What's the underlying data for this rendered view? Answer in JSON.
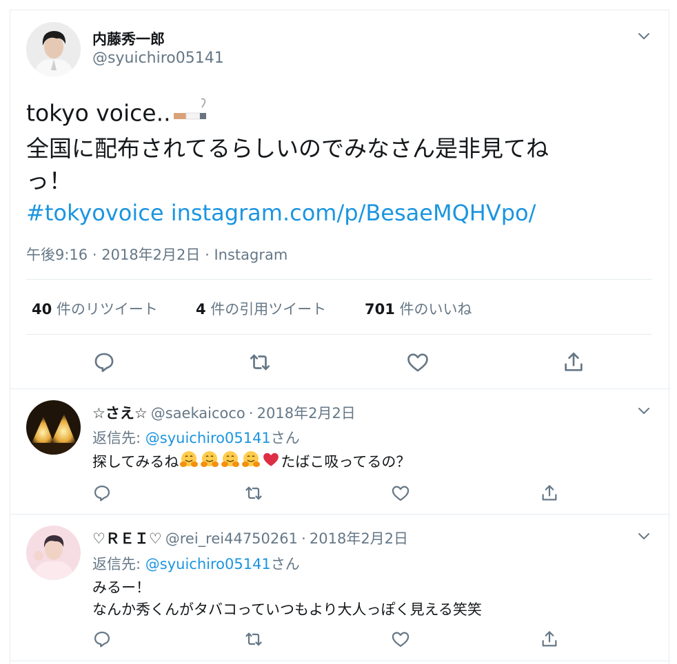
{
  "main_tweet": {
    "display_name": "内藤秀一郎",
    "handle": "@syuichiro05141",
    "text_line1": "tokyo voice..",
    "text_line2": "全国に配布されてるらしいのでみなさん是非見てね",
    "text_line3": "っ！",
    "hashtag": "#tokyovoice",
    "link": "instagram.com/p/BesaeMQHVpo/",
    "time": "午後9:16",
    "date": "2018年2月2日",
    "source": "Instagram",
    "separator": "·",
    "stats": {
      "retweets_count": "40",
      "retweets_label": "件のリツイート",
      "quotes_count": "4",
      "quotes_label": "件の引用ツイート",
      "likes_count": "701",
      "likes_label": "件のいいね"
    }
  },
  "replies": [
    {
      "display_name": "☆さえ☆",
      "handle": "@saekaicoco",
      "date": "2018年2月2日",
      "reply_to_label": "返信先:",
      "reply_to_handle": "@syuichiro05141",
      "reply_to_suffix": "さん",
      "text_before": "探してみるね",
      "text_after": "たばこ吸ってるの？"
    },
    {
      "display_name": "♡ＲＥＩ♡",
      "handle": "@rei_rei44750261",
      "date": "2018年2月2日",
      "reply_to_label": "返信先:",
      "reply_to_handle": "@syuichiro05141",
      "reply_to_suffix": "さん",
      "text_line1": "みるー！",
      "text_line2": "なんか秀くんがタバコっていつもより大人っぽく見える笑笑"
    }
  ],
  "colors": {
    "link": "#1b95e0",
    "secondary_text": "#657786",
    "divider": "#e6ecf0",
    "heart_red": "#e0245e"
  },
  "icons": [
    "chevron-down-icon",
    "reply-icon",
    "retweet-icon",
    "like-icon",
    "share-icon",
    "cigarette-emoji",
    "hugging-face-emoji",
    "red-heart-emoji"
  ]
}
